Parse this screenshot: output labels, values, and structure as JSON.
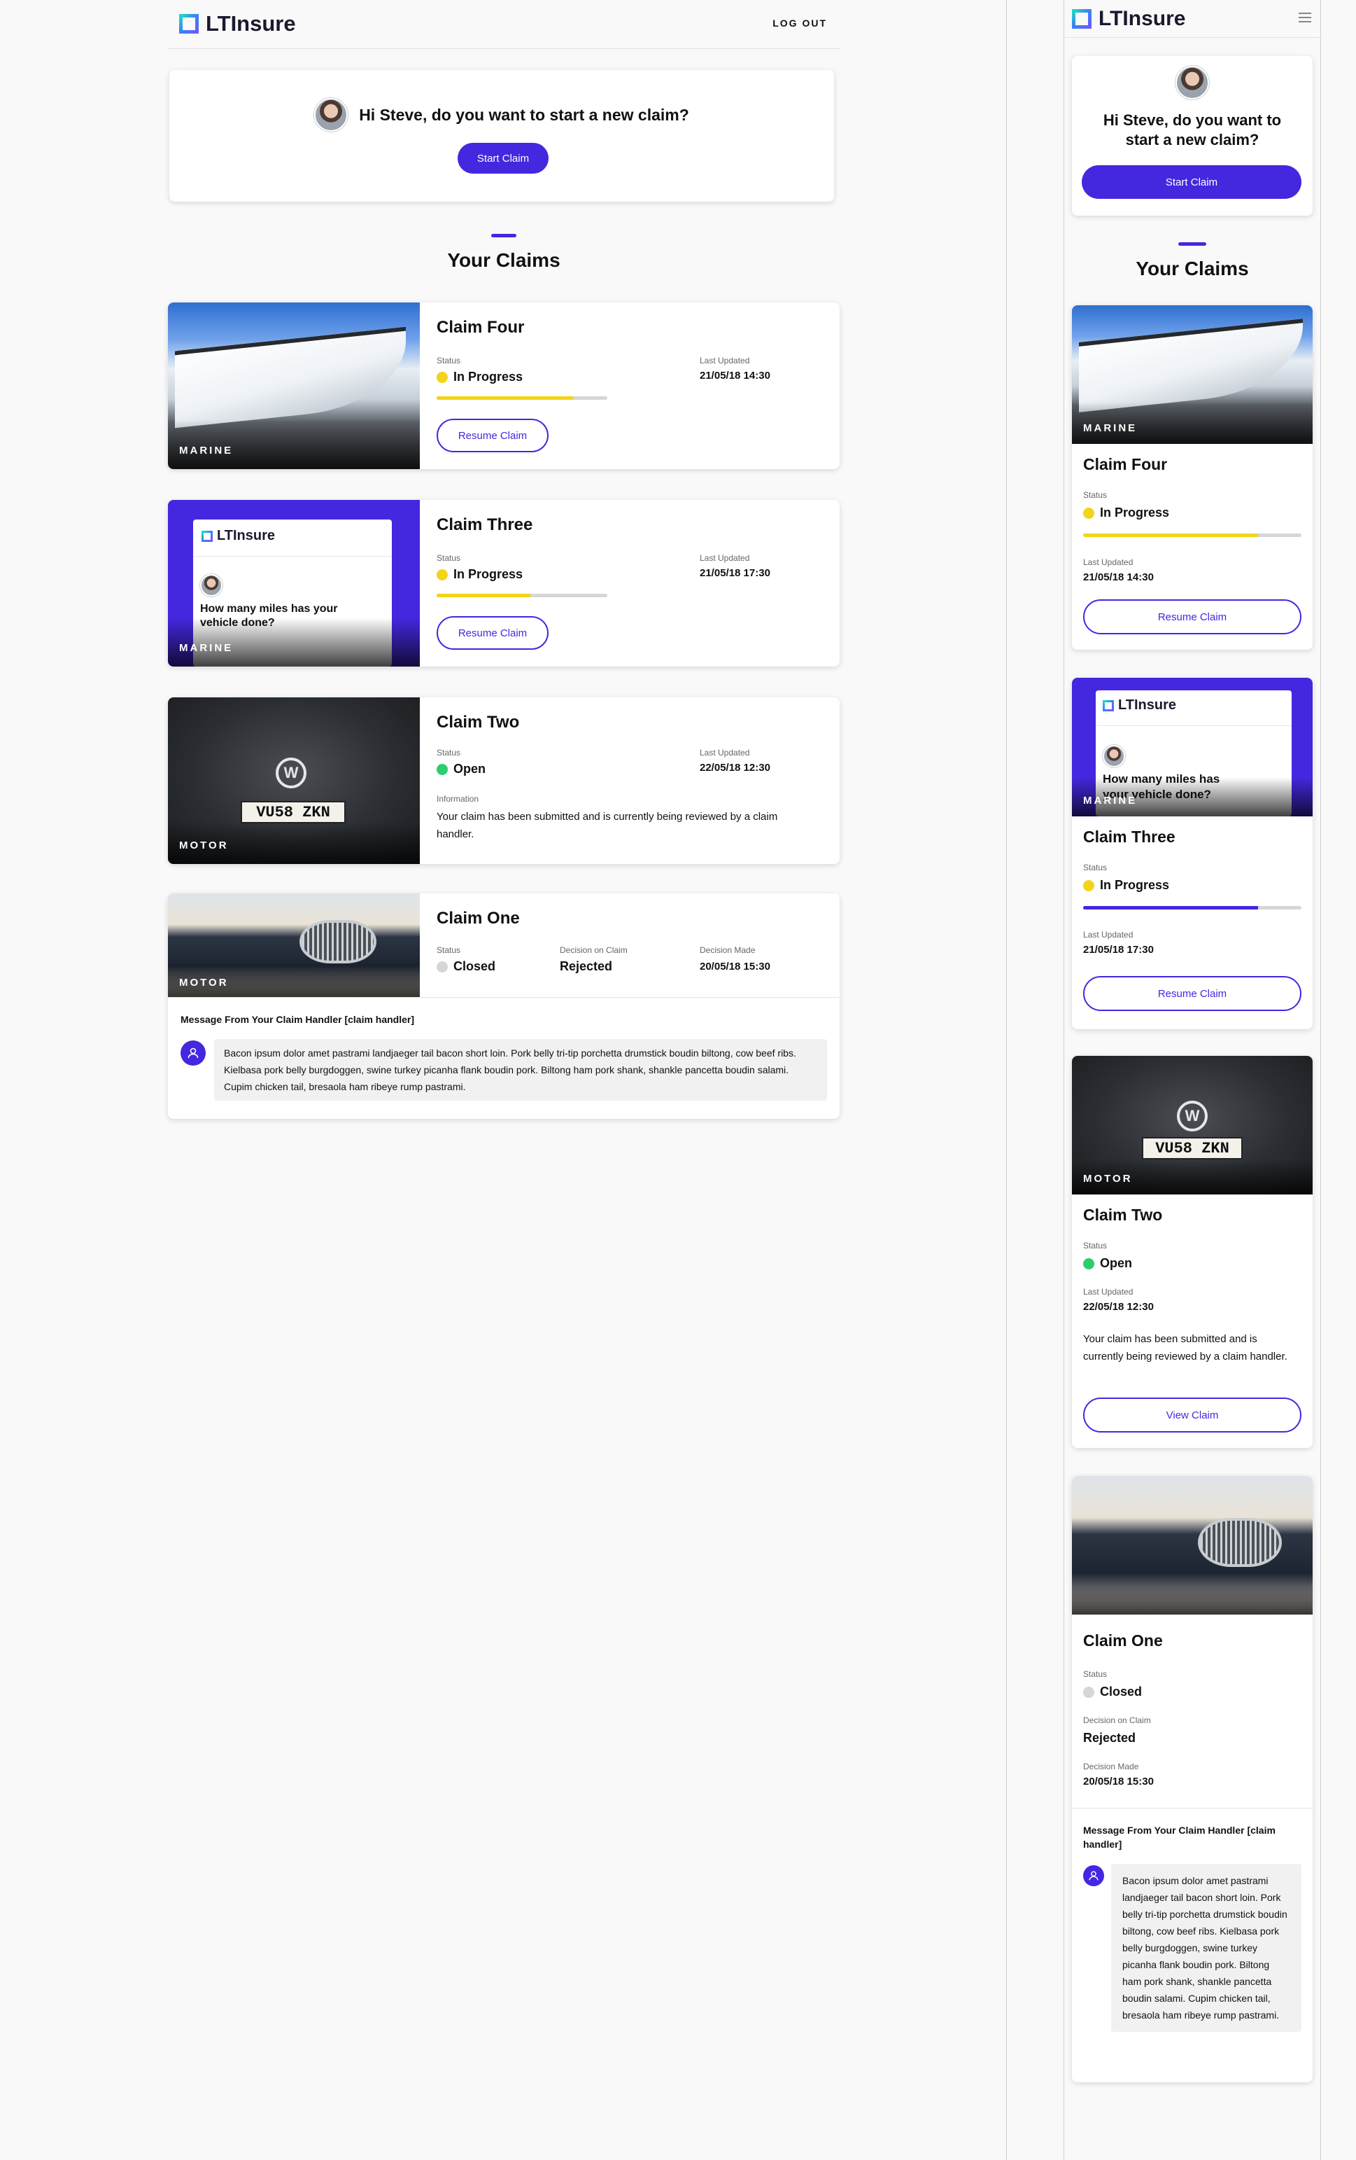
{
  "brand": {
    "name": "LTInsure"
  },
  "header": {
    "logout": "LOG OUT"
  },
  "welcome": {
    "question": "Hi Steve, do you want to start a new claim?",
    "start_button": "Start Claim"
  },
  "section": {
    "title": "Your Claims"
  },
  "labels": {
    "status": "Status",
    "last_updated": "Last Updated",
    "information": "Information",
    "decision_on_claim": "Decision on Claim",
    "decision_made": "Decision Made"
  },
  "colors": {
    "accent": "#4328e0",
    "in_progress": "#f2d41a",
    "open": "#2ecc71",
    "closed": "#d6d6d6"
  },
  "claims": [
    {
      "title": "Claim Four",
      "tag": "MARINE",
      "status": "In Progress",
      "last_updated": "21/05/18 14:30",
      "progress": 0.8,
      "button": "Resume Claim"
    },
    {
      "title": "Claim Three",
      "tag": "MARINE",
      "status": "In Progress",
      "last_updated": "21/05/18 17:30",
      "progress": 0.55,
      "button": "Resume Claim",
      "screen_question": "How many miles has your vehicle done?",
      "screen_brand": "LTInsure"
    },
    {
      "title": "Claim Two",
      "tag": "MOTOR",
      "status": "Open",
      "last_updated": "22/05/18 12:30",
      "information": "Your claim has been submitted and is currently being reviewed by a claim handler.",
      "button": "View Claim",
      "plate": "VU58 ZKN"
    },
    {
      "title": "Claim One",
      "tag": "MOTOR",
      "status": "Closed",
      "decision": "Rejected",
      "decision_made": "20/05/18 15:30",
      "message_title": "Message From Your Claim Handler [claim handler]",
      "message": "Bacon ipsum dolor amet pastrami landjaeger tail bacon short loin. Pork belly tri-tip porchetta drumstick boudin biltong, cow beef ribs. Kielbasa pork belly burgdoggen, swine turkey picanha flank boudin pork. Biltong ham pork shank, shankle pancetta boudin salami. Cupim chicken tail, bresaola ham ribeye rump pastrami."
    }
  ],
  "icons": {
    "menu": "hamburger-icon",
    "user": "user-icon",
    "vw": "vw-logo",
    "logo": "ltinsure-logo-icon"
  }
}
